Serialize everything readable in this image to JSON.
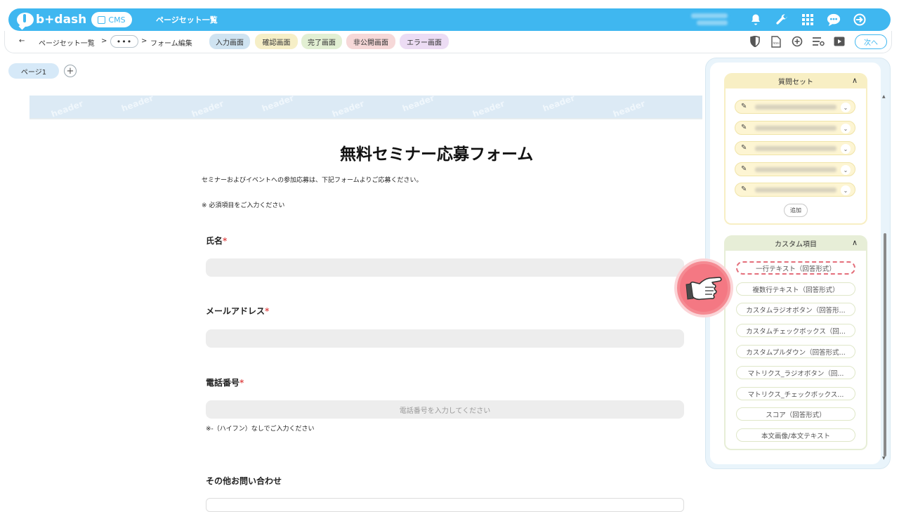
{
  "header": {
    "logo_text": "b+dash",
    "cms_label": "CMS",
    "title": "ページセット一覧"
  },
  "breadcrumb": {
    "back_label": "←",
    "item1": "ページセット一覧",
    "sep1": ">",
    "ellipsis": "•••",
    "sep2": ">",
    "item2": "フォーム編集"
  },
  "tabs": [
    {
      "label": "入力画面",
      "color": "#cfe3f1"
    },
    {
      "label": "確認画面",
      "color": "#f6efc7"
    },
    {
      "label": "完了画面",
      "color": "#e2efd3"
    },
    {
      "label": "非公開画面",
      "color": "#f6d8d8"
    },
    {
      "label": "エラー画面",
      "color": "#ecdcf4"
    }
  ],
  "toolbar": {
    "next_label": "次へ"
  },
  "page": {
    "tab_label": "ページ1",
    "add_label": "+"
  },
  "banner": {
    "watermark": "header"
  },
  "form": {
    "title": "無料セミナー応募フォーム",
    "description": "セミナーおよびイベントへの参加応募は、下記フォームよりご応募ください。",
    "required_note": "※ 必須項目をご入力ください",
    "fields": [
      {
        "label": "氏名",
        "required_mark": "*",
        "placeholder": ""
      },
      {
        "label": "メールアドレス",
        "required_mark": "*",
        "placeholder": ""
      },
      {
        "label": "電話番号",
        "required_mark": "*",
        "placeholder": "電話番号を入力してください"
      },
      {
        "label": "その他お問い合わせ",
        "required_mark": "",
        "placeholder": ""
      }
    ],
    "phone_hint": "※-（ハイフン）なしでご入力ください"
  },
  "panel": {
    "question_set": {
      "title": "質問セット",
      "toggle": "∧",
      "add_label": "追加",
      "accent": "#f8efc4"
    },
    "custom_items": {
      "title": "カスタム項目",
      "toggle": "∧",
      "accent": "#e7eed7",
      "items": [
        "一行テキスト（回答形式）",
        "複数行テキスト（回答形式）",
        "カスタムラジオボタン（回答形...",
        "カスタムチェックボックス（回...",
        "カスタムプルダウン（回答形式...",
        "マトリクス_ラジオボタン（回...",
        "マトリクス_チェックボックス...",
        "スコア（回答形式）",
        "本文画像/本文テキスト"
      ]
    }
  },
  "colors": {
    "brand": "#3fb7f0",
    "highlight": "#e46f7b",
    "required": "#e05050"
  }
}
